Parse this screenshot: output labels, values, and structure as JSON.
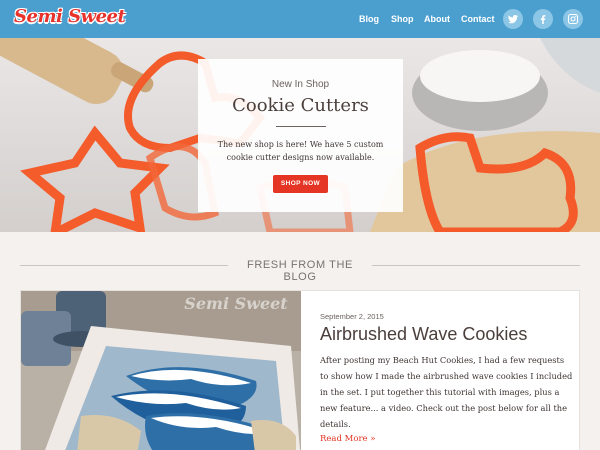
{
  "header": {
    "logo": "Semi Sweet",
    "nav": [
      "Blog",
      "Shop",
      "About",
      "Contact"
    ],
    "social": [
      "twitter-icon",
      "facebook-icon",
      "instagram-icon"
    ],
    "bar_color": "#4b9fcf"
  },
  "hero": {
    "kicker": "New In Shop",
    "title": "Cookie Cutters",
    "text": "The new shop is here! We have 5 custom cookie cutter designs now available.",
    "button": "SHOP NOW"
  },
  "section": {
    "title": "FRESH FROM THE BLOG"
  },
  "post": {
    "date": "September 2, 2015",
    "title": "Airbrushed Wave Cookies",
    "excerpt": "After posting my Beach Hut Cookies, I had a few requests to show how I made the airbrushed wave cookies I included in the set. I put together this tutorial with images, plus a new feature... a video. Check out the post below for all the details.",
    "read_more": "Read More »",
    "watermark": "Semi Sweet"
  },
  "colors": {
    "accent": "#e53524",
    "text": "#4a3f3b",
    "background": "#f4f1ee"
  }
}
